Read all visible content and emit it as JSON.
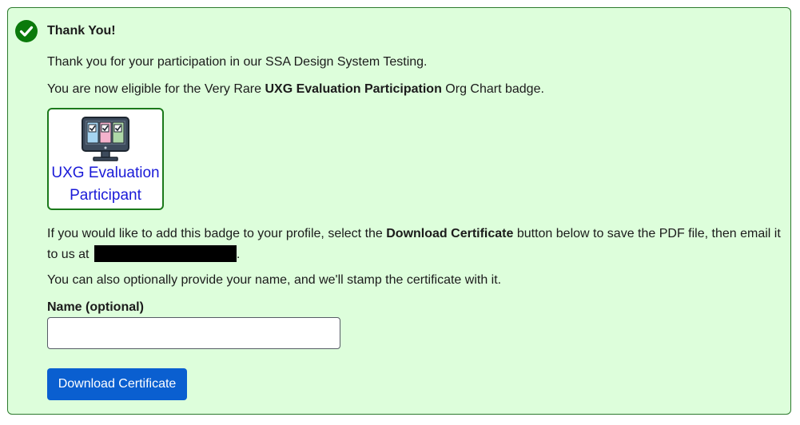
{
  "alert": {
    "heading": "Thank You!",
    "status_icon": "check-circle-icon",
    "accent_color": "#0b7a0b",
    "background_color": "#ddfedb"
  },
  "content": {
    "thanks_text": "Thank you for your participation in our SSA Design System Testing.",
    "eligible_prefix": "You are now eligible for the Very Rare ",
    "eligible_badge_name": "UXG Evaluation Participation",
    "eligible_suffix": " Org Chart badge.",
    "badge": {
      "icon": "monitor-checklist-icon",
      "label": "UXG Evaluation Participant"
    },
    "instructions_prefix": "If you would like to add this badge to your profile, select the ",
    "instructions_button_ref": "Download Certificate",
    "instructions_suffix": " button below to save the PDF file, then email it to us at ",
    "instructions_end": ".",
    "stamp_text": "You can also optionally provide your name, and we'll stamp the certificate with it."
  },
  "form": {
    "name_label": "Name (optional)",
    "name_value": "",
    "name_placeholder": "",
    "download_button": "Download Certificate"
  }
}
